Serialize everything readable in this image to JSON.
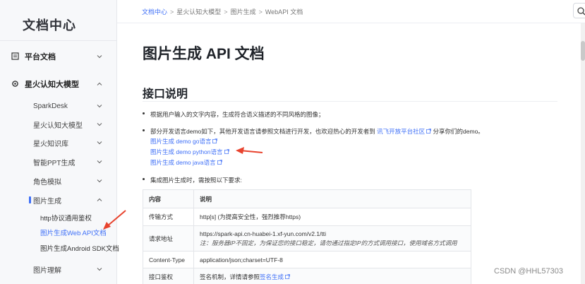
{
  "sidebar": {
    "logo": "文档中心",
    "sections": [
      {
        "label": "平台文档"
      },
      {
        "label": "星火认知大模型"
      }
    ],
    "items": [
      {
        "label": "SparkDesk"
      },
      {
        "label": "星火认知大模型"
      },
      {
        "label": "星火知识库"
      },
      {
        "label": "智能PPT生成"
      },
      {
        "label": "角色模拟"
      },
      {
        "label": "图片生成"
      }
    ],
    "sub_items": [
      {
        "label": "http协议通用鉴权"
      },
      {
        "label": "图片生成Web API文档"
      },
      {
        "label": "图片生成Android SDK文档"
      }
    ],
    "bottom_item": {
      "label": "图片理解"
    }
  },
  "breadcrumb": {
    "items": [
      "文档中心",
      "星火认知大模型",
      "图片生成",
      "WebAPI 文档"
    ],
    "separator": ">"
  },
  "main": {
    "title": "图片生成 API 文档",
    "section_title": "接口说明",
    "bullet1": "根据用户输入的文字内容，生成符合语义描述的不同风格的图像；",
    "bullet2_pre": "部分开发语言demo如下，其他开发语言请参照文档进行开发，也欢迎热心的开发者到",
    "bullet2_link": "讯飞开放平台社区",
    "bullet2_post": "分享你们的demo。",
    "demo_links": [
      "图片生成 demo go语言",
      "图片生成 demo python语言",
      "图片生成 demo java语言"
    ],
    "bullet3": "集成图片生成时，需按照以下要求:"
  },
  "table": {
    "headers": [
      "内容",
      "说明"
    ],
    "rows": [
      {
        "k": "传输方式",
        "v": "http[s] (为提高安全性，强烈推荐https)"
      },
      {
        "k": "请求地址",
        "v": "https://spark-api.cn-huabei-1.xf-yun.com/v2.1/tti",
        "note": "注：服务器IP不固定，为保证您的接口稳定，请勿通过指定IP的方式调用接口，使用域名方式调用"
      },
      {
        "k": "Content-Type",
        "v": "application/json;charset=UTF-8"
      },
      {
        "k": "接口鉴权",
        "v_pre": "签名机制，详情请参照",
        "v_link": "签名生成"
      }
    ]
  },
  "watermark": "CSDN @HHL57303",
  "colors": {
    "accent": "#3e6ff7",
    "arrow": "#e8432e",
    "sidebar_bg": "#f7f8fa"
  }
}
